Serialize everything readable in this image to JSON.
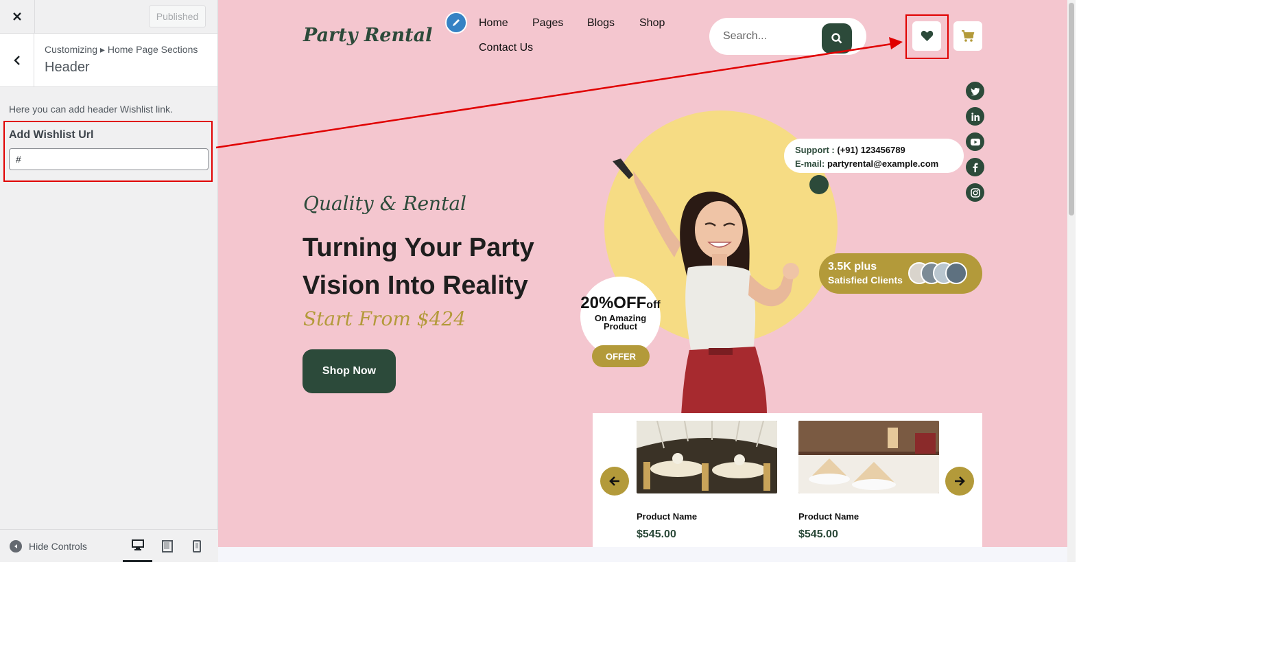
{
  "customizer": {
    "close_icon": "close-icon",
    "publish_label": "Published",
    "breadcrumb": "Customizing ▸ Home Page Sections",
    "section_title": "Header",
    "description": "Here you can add header Wishlist link.",
    "field_label": "Add Wishlist Url",
    "field_value": "#",
    "hide_controls": "Hide Controls"
  },
  "site": {
    "logo": "Party Rental",
    "nav": [
      "Home",
      "Pages",
      "Blogs",
      "Shop",
      "Contact Us"
    ],
    "search_placeholder": "Search...",
    "socials": [
      "twitter-icon",
      "linkedin-icon",
      "youtube-icon",
      "facebook-icon",
      "instagram-icon"
    ],
    "hero": {
      "tagline": "Quality & Rental",
      "headline": "Turning Your Party Vision Into Reality",
      "price_line": "Start From $424",
      "cta": "Shop Now"
    },
    "support": {
      "support_key": "Support :",
      "support_value": "(+91) 123456789",
      "email_key": "E-mail:",
      "email_value": "partyrental@example.com"
    },
    "clients": {
      "count": "3.5K plus",
      "label": "Satisfied Clients"
    },
    "offer": {
      "big": "20%OFF",
      "small": "off",
      "sub": "On Amazing Product",
      "pill": "OFFER"
    },
    "products": [
      {
        "name": "Product Name",
        "price": "$545.00"
      },
      {
        "name": "Product Name",
        "price": "$545.00"
      }
    ]
  },
  "colors": {
    "brand_green": "#2c4a3a",
    "brand_gold": "#b39a3a",
    "page_pink": "#f4c6cf",
    "annotation_red": "#e00000"
  }
}
